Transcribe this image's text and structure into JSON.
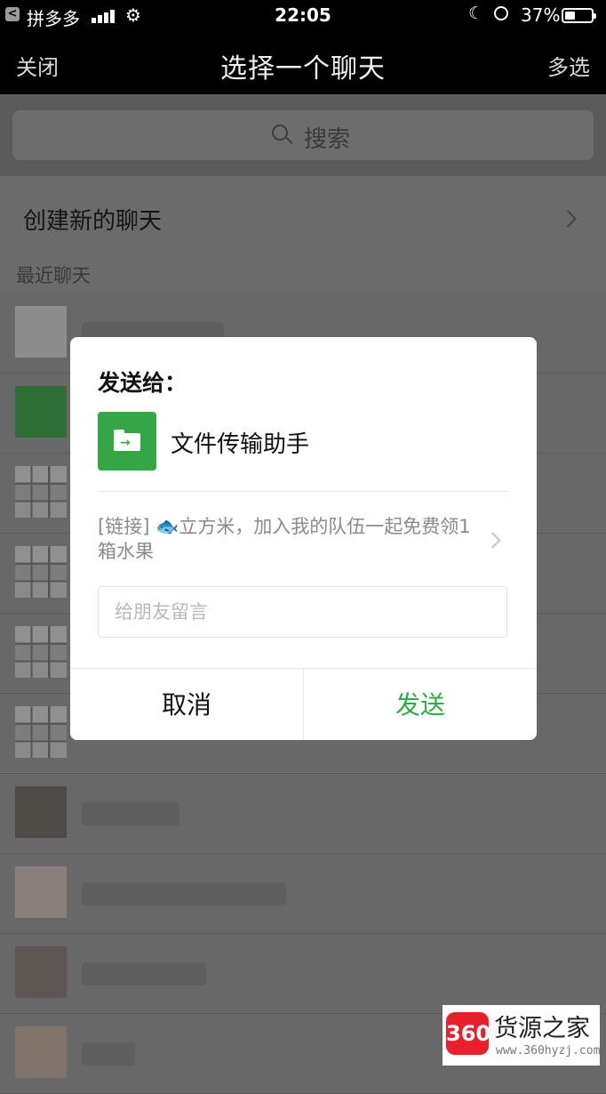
{
  "status_bar": {
    "back_glyph": "<",
    "app": "拼多多",
    "time": "22:05",
    "battery": "37%"
  },
  "nav": {
    "close": "关闭",
    "title": "选择一个聊天",
    "multi_select": "多选"
  },
  "search": {
    "placeholder": "搜索"
  },
  "new_chat": "创建新的聊天",
  "recent_label": "最近聊天",
  "dialog": {
    "title": "发送给：",
    "recipient": "文件传输助手",
    "message": "[链接] 🐟立方米，加入我的队伍一起免费领1箱水果",
    "input_placeholder": "给朋友留言",
    "cancel": "取消",
    "send": "发送",
    "send_color": "#2aae3f",
    "avatar_color": "#34a646"
  },
  "watermark": {
    "logo": "360",
    "name": "货源之家",
    "url": "www.360hyzj.com"
  },
  "icons": [
    "back-icon",
    "signal-icon",
    "wifi-icon",
    "moon-icon",
    "rotation-lock-icon",
    "battery-icon",
    "search-icon",
    "chevron-right-icon",
    "folder-icon"
  ]
}
